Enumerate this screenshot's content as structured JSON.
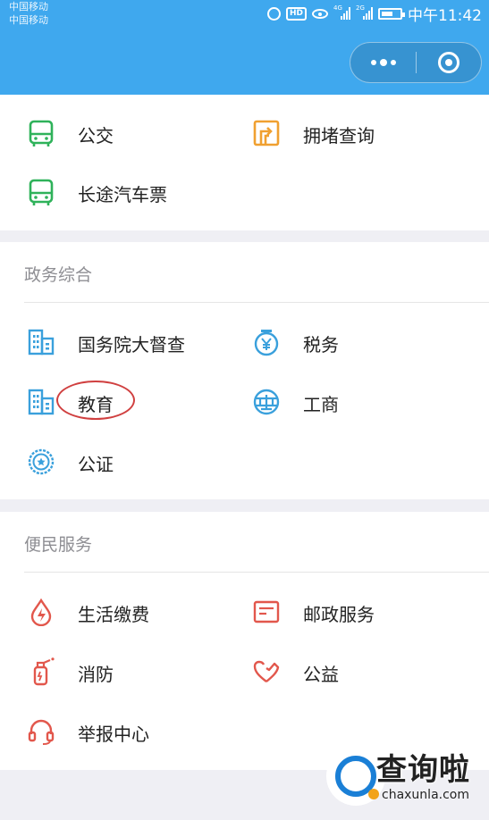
{
  "status_bar": {
    "carrier_1": "中国移动",
    "carrier_2": "中国移动",
    "hd": "HD",
    "net_1": "4G",
    "net_2": "2G",
    "time": "中午11:42"
  },
  "colors": {
    "header": "#3fa8ee",
    "green": "#2fb25a",
    "orange": "#f0a030",
    "blue": "#3aa0dc",
    "red": "#e2574c"
  },
  "transport": {
    "items": [
      {
        "label": "公交",
        "icon": "bus-icon"
      },
      {
        "label": "拥堵查询",
        "icon": "road-sign-icon"
      },
      {
        "label": "长途汽车票",
        "icon": "coach-icon"
      }
    ]
  },
  "government": {
    "title": "政务综合",
    "items": [
      {
        "label": "国务院大督查",
        "icon": "building-icon"
      },
      {
        "label": "税务",
        "icon": "tax-coin-icon"
      },
      {
        "label": "教育",
        "icon": "school-building-icon"
      },
      {
        "label": "工商",
        "icon": "business-seal-icon"
      },
      {
        "label": "公证",
        "icon": "notary-stamp-icon"
      }
    ]
  },
  "services": {
    "title": "便民服务",
    "items": [
      {
        "label": "生活缴费",
        "icon": "water-drop-icon"
      },
      {
        "label": "邮政服务",
        "icon": "mail-icon"
      },
      {
        "label": "消防",
        "icon": "fire-extinguisher-icon"
      },
      {
        "label": "公益",
        "icon": "heart-hands-icon"
      },
      {
        "label": "举报中心",
        "icon": "headset-icon"
      }
    ]
  },
  "watermark": {
    "text": "查询啦",
    "url": "chaxunla.com"
  }
}
